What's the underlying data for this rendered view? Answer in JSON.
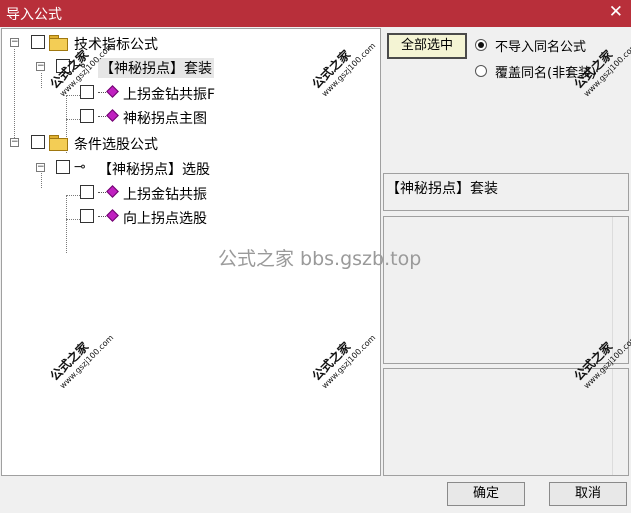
{
  "window": {
    "title": "导入公式",
    "close_glyph": "✕"
  },
  "tree": {
    "nodes": [
      {
        "label": "技术指标公式",
        "type": "folder",
        "toggle": "−"
      },
      {
        "label": "【神秘拐点】套装",
        "type": "key",
        "toggle": "−"
      },
      {
        "label": "上拐金钻共振F",
        "type": "gem"
      },
      {
        "label": "神秘拐点主图",
        "type": "gem"
      },
      {
        "label": "条件选股公式",
        "type": "folder",
        "toggle": "−"
      },
      {
        "label": "【神秘拐点】选股",
        "type": "key",
        "toggle": "−"
      },
      {
        "label": "上拐金钻共振",
        "type": "gem"
      },
      {
        "label": "向上拐点选股",
        "type": "gem"
      }
    ],
    "key_glyph": "⊸"
  },
  "options": {
    "select_all": "全部选中",
    "radio_no_import": "不导入同名公式",
    "radio_overwrite": "覆盖同名(非套装)",
    "selected_radio": "no_import"
  },
  "detail": {
    "name": "【神秘拐点】套装"
  },
  "footer": {
    "ok": "确定",
    "cancel": "取消"
  },
  "watermark": {
    "brand": "公式之家",
    "url": "www.gszj100.com",
    "center": "公式之家 bbs.gszb.top"
  }
}
